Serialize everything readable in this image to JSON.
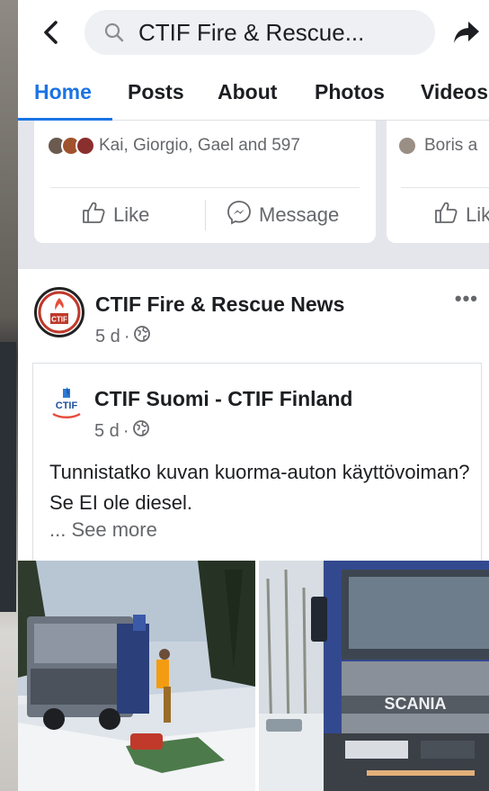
{
  "header": {
    "search_query": "CTIF Fire & Rescue..."
  },
  "tabs": [
    {
      "label": "Home",
      "active": true
    },
    {
      "label": "Posts"
    },
    {
      "label": "About"
    },
    {
      "label": "Photos"
    },
    {
      "label": "Videos"
    }
  ],
  "friend_cards": [
    {
      "friends_text": "Kai, Giorgio, Gael and 597",
      "like_label": "Like",
      "message_label": "Message"
    },
    {
      "friends_text": "Boris a",
      "like_label": "Lik"
    }
  ],
  "post": {
    "page_name": "CTIF Fire & Rescue News",
    "time": "5 d",
    "separator": "·",
    "more_label": "•••",
    "shared": {
      "page_name": "CTIF Suomi - CTIF Finland",
      "time": "5 d",
      "separator": "·",
      "text": "Tunnistatko kuvan kuorma-auton käyttövoiman? Se EI ole diesel.",
      "see_more": "... See more"
    },
    "photo_truck_brand": "SCANIA",
    "logo_text": "CTIF",
    "sub_logo_text": "CTIF"
  },
  "colors": {
    "accent": "#1b74e4",
    "text": "#1c1e21",
    "secondary": "#65676b",
    "feed_bg": "#e4e6eb"
  },
  "icons": [
    "back-arrow-icon",
    "search-icon",
    "share-arrow-icon",
    "like-thumb-icon",
    "messenger-icon",
    "globe-icon",
    "more-dots-icon"
  ]
}
